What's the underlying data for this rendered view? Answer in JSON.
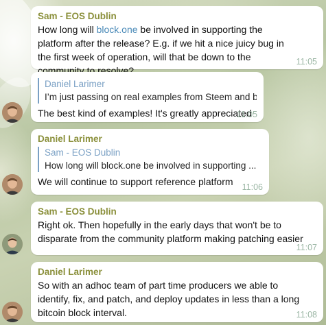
{
  "messages": [
    {
      "sender": "Sam - EOS Dublin",
      "text_before_link": "How long will ",
      "link": "block.one",
      "text_after_link": " be involved in supporting the platform after the release? E.g. if we hit a nice juicy bug in the first week of operation, will that be down to the community to resolve?",
      "time": "11:05"
    },
    {
      "reply_to": "Daniel Larimer",
      "reply_text": "I’m just passing on real examples from Steem and bit...",
      "text": "The best kind of examples! It's greatly appreciated",
      "time": "11:05"
    },
    {
      "sender": "Daniel Larimer",
      "reply_to": "Sam - EOS Dublin",
      "reply_text": "How long will block.one be involved in supporting ...",
      "text": "We will continue to support reference platform",
      "time": "11:06"
    },
    {
      "sender": "Sam - EOS Dublin",
      "text": "Right ok. Then hopefully in the early days that won't be to disparate from the community platform making patching easier",
      "time": "11:07"
    },
    {
      "sender": "Daniel Larimer",
      "text": "So with an adhoc team of part time producers we able to identify, fix, and patch, and deploy updates in less than a long bitcoin block interval.",
      "time": "11:08"
    }
  ],
  "colors": {
    "sender": "#8a8f3a",
    "link": "#4a8ab8",
    "reply_bar": "#7aa0c4",
    "time": "#9bb6a4",
    "bubble": "#ffffff"
  },
  "icons": [
    "avatar-daniel-larimer",
    "avatar-sam-eos-dublin"
  ]
}
